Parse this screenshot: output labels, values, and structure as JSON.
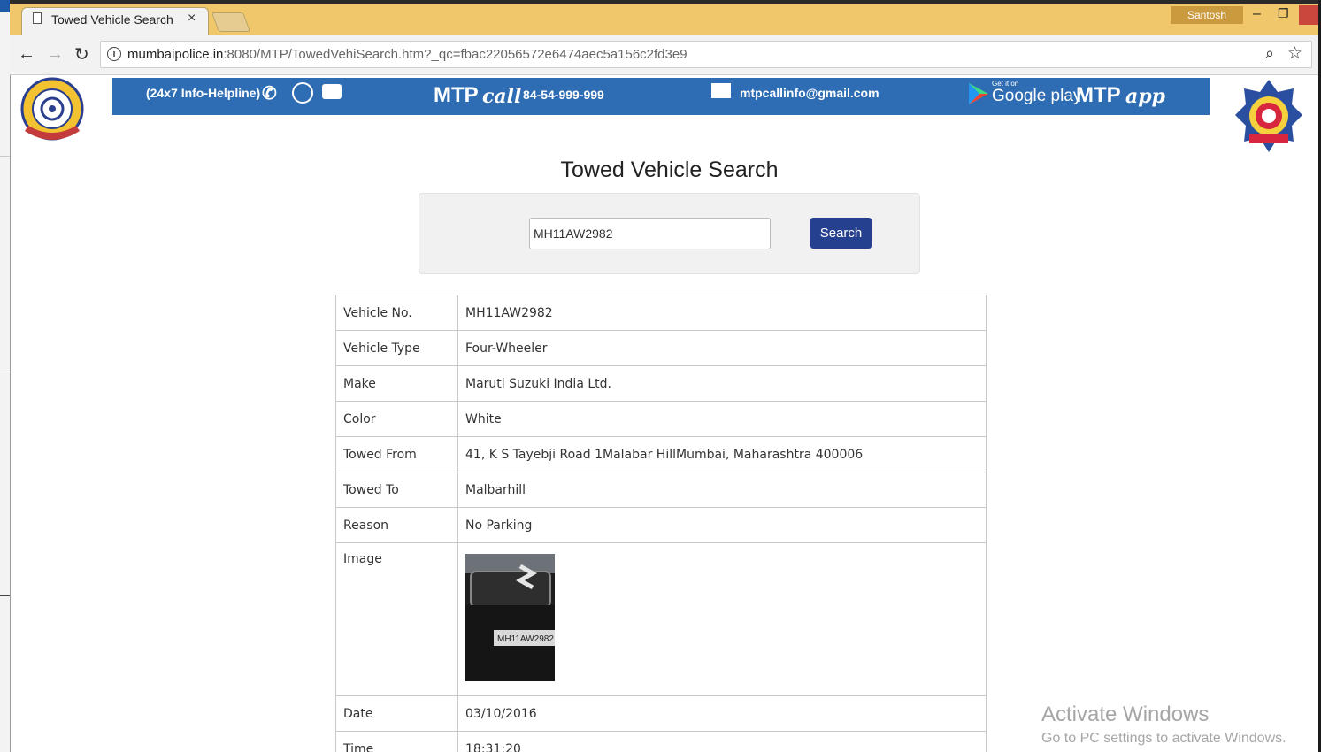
{
  "browser": {
    "tab_title": "Towed Vehicle Search",
    "tab_close": "×",
    "user_name": "Santosh",
    "url_host": "mumbaipolice.in",
    "url_rest": ":8080/MTP/TowedVehiSearch.htm?_qc=fbac22056572e6474aec5a156c2fd3e9"
  },
  "banner": {
    "helpline": "(24x7 Info-Helpline)",
    "brand": "MTP",
    "call_word": "call",
    "phone": "84-54-999-999",
    "email": "mtpcallinfo@gmail.com",
    "store_get_it_on": "Get it on",
    "store_name": "Google play",
    "brand2": "MTP",
    "app_word": "app",
    "accent_color": "#2e6db4"
  },
  "page": {
    "title": "Towed Vehicle Search"
  },
  "search": {
    "value": "MH11AW2982",
    "button_label": "Search",
    "button_color": "#25408f"
  },
  "result": {
    "rows": [
      {
        "label": "Vehicle No.",
        "value": "MH11AW2982"
      },
      {
        "label": "Vehicle Type",
        "value": "Four-Wheeler"
      },
      {
        "label": "Make",
        "value": "Maruti Suzuki India Ltd."
      },
      {
        "label": "Color",
        "value": "White"
      },
      {
        "label": "Towed From",
        "value": "41, K S Tayebji Road 1Malabar HillMumbai, Maharashtra 400006"
      },
      {
        "label": "Towed To",
        "value": "Malbarhill"
      },
      {
        "label": "Reason",
        "value": "No Parking"
      }
    ],
    "image_label": "Image",
    "image_plate_text": "MH11AW2982",
    "after_rows": [
      {
        "label": "Date",
        "value": "03/10/2016"
      },
      {
        "label": "Time",
        "value": "18:31:20"
      }
    ]
  },
  "watermark": {
    "title": "Activate Windows",
    "subtitle": "Go to PC settings to activate Windows."
  }
}
